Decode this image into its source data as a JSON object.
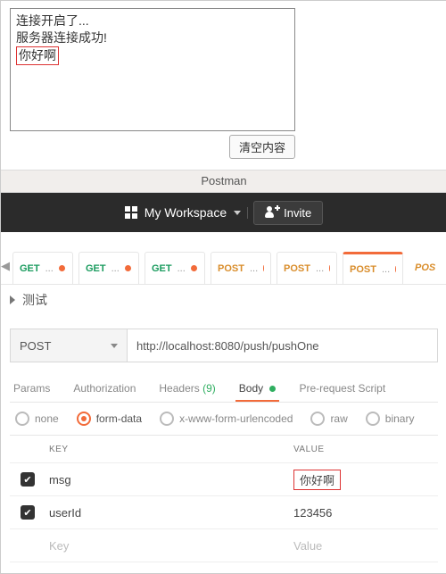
{
  "console": {
    "lines": [
      "连接开启了...",
      "服务器连接成功!"
    ],
    "highlight_line": "你好啊",
    "clear_label": "清空内容"
  },
  "window_title": "Postman",
  "topnav": {
    "workspace_label": "My Workspace",
    "invite_label": "Invite"
  },
  "request_tabs": [
    {
      "method": "GET",
      "label": "...",
      "unsaved": true,
      "active": false
    },
    {
      "method": "GET",
      "label": "...",
      "unsaved": true,
      "active": false
    },
    {
      "method": "GET",
      "label": "...",
      "unsaved": true,
      "active": false
    },
    {
      "method": "POST",
      "label": "...",
      "unsaved": true,
      "active": false
    },
    {
      "method": "POST",
      "label": "...",
      "unsaved": true,
      "active": false
    },
    {
      "method": "POST",
      "label": "...",
      "unsaved": true,
      "active": true
    }
  ],
  "request_tab_overflow": "POS",
  "request_name": "测试",
  "method": "POST",
  "url": "http://localhost:8080/push/pushOne",
  "subtabs": {
    "params": "Params",
    "auth": "Authorization",
    "headers_label": "Headers",
    "headers_count": "(9)",
    "body": "Body",
    "prerequest": "Pre-request Script"
  },
  "body_types": {
    "none": "none",
    "formdata": "form-data",
    "urlencoded": "x-www-form-urlencoded",
    "raw": "raw",
    "binary": "binary"
  },
  "form_table": {
    "key_header": "KEY",
    "value_header": "VALUE",
    "rows": [
      {
        "enabled": true,
        "key": "msg",
        "value": "你好啊",
        "value_highlight": true
      },
      {
        "enabled": true,
        "key": "userId",
        "value": "123456",
        "value_highlight": false
      }
    ],
    "placeholder_key": "Key",
    "placeholder_value": "Value"
  }
}
